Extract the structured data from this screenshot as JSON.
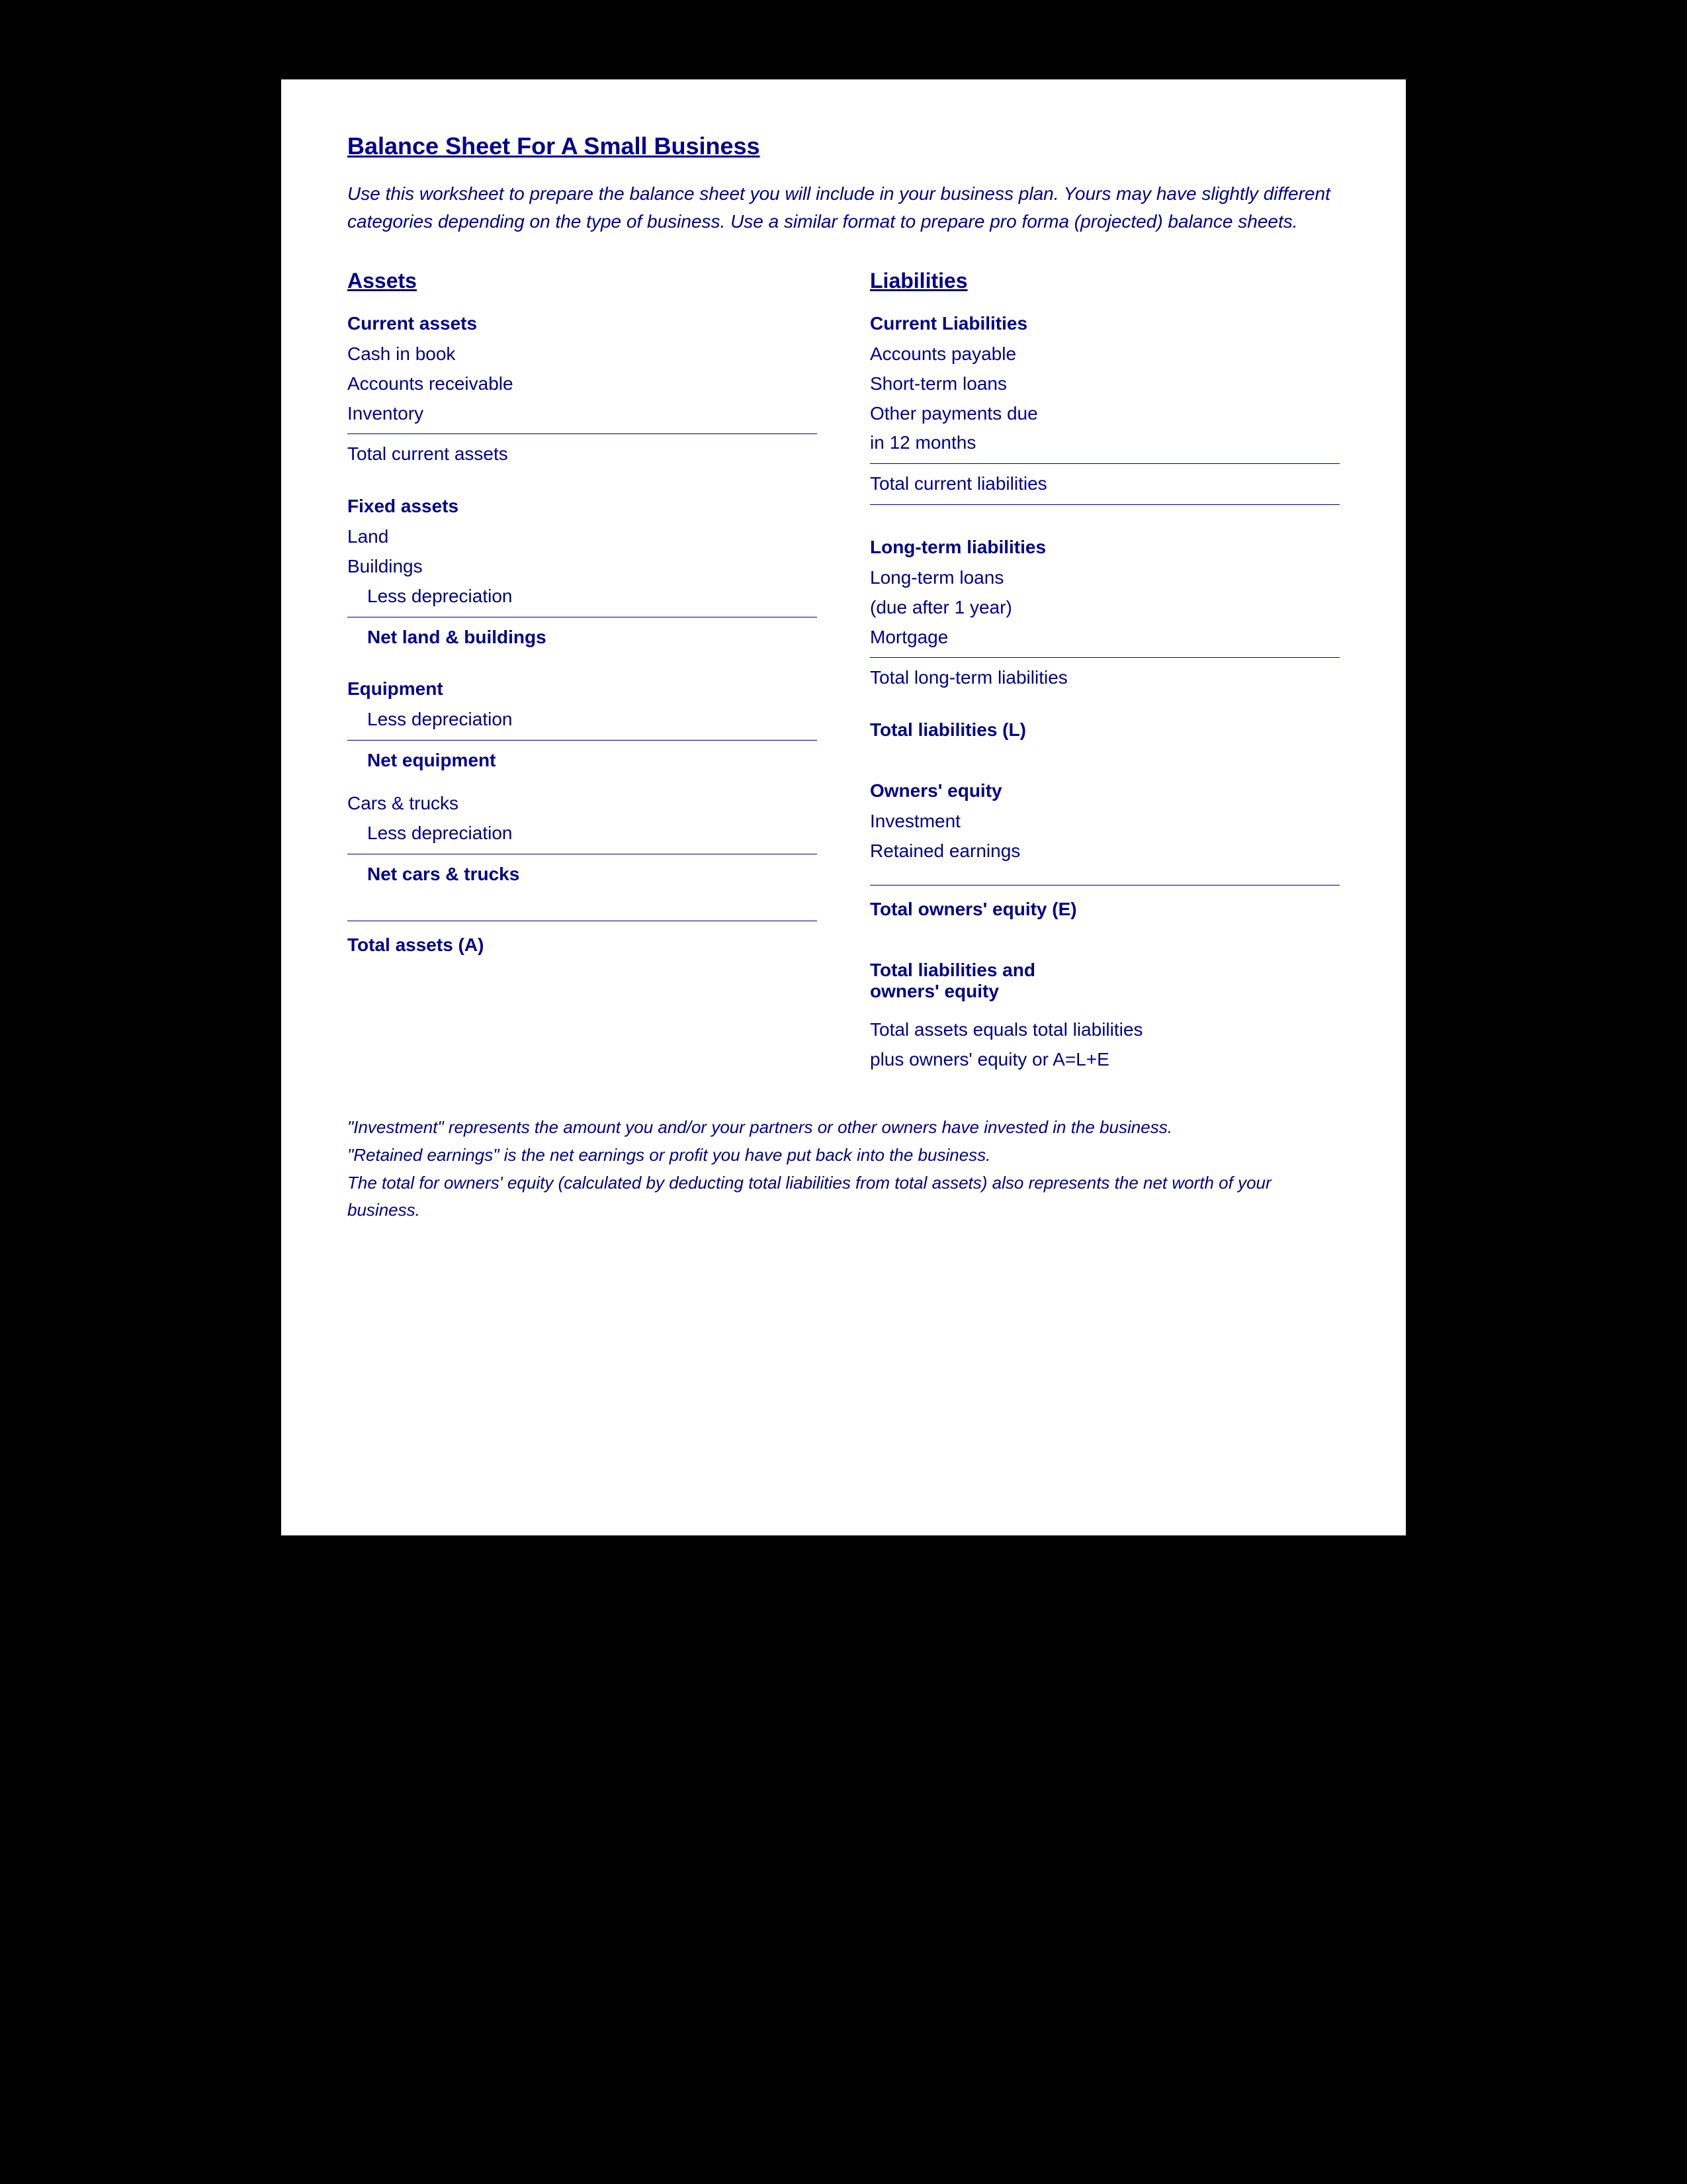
{
  "page": {
    "title": "Balance Sheet For A Small Business",
    "intro": "Use this worksheet to prepare the balance sheet you will include in your business plan.  Yours may have slightly different categories depending on the type of business.  Use a similar format to prepare pro forma (projected) balance sheets.",
    "assets": {
      "header": "Assets",
      "current_assets": {
        "header": "Current assets",
        "items": [
          "Cash in book",
          "Accounts receivable",
          "Inventory",
          "Total current assets"
        ]
      },
      "fixed_assets": {
        "header": "Fixed assets",
        "items": [
          "Land",
          "Buildings",
          "Less depreciation",
          "Net land & buildings"
        ]
      },
      "equipment": {
        "header": "Equipment",
        "items": [
          "Less depreciation",
          "Net equipment"
        ]
      },
      "cars_trucks": {
        "header": "Cars & trucks",
        "items": [
          "Less depreciation",
          "Net cars & trucks"
        ]
      },
      "total": "Total assets (A)"
    },
    "liabilities": {
      "header": "Liabilities",
      "current_liabilities": {
        "header": "Current Liabilities",
        "items": [
          "Accounts payable",
          "Short-term loans",
          "Other payments due",
          " in 12 months",
          "Total current liabilities"
        ]
      },
      "long_term": {
        "header": "Long-term liabilities",
        "items": [
          "Long-term loans",
          " (due after 1 year)",
          "Mortgage",
          "Total long-term liabilities"
        ]
      },
      "total_liabilities": "Total liabilities (L)",
      "owners_equity": {
        "header": "Owners' equity",
        "items": [
          "Investment",
          "Retained earnings"
        ]
      },
      "total_equity": "Total owners' equity (E)",
      "total_liabilities_equity": {
        "line1": "Total liabilities and",
        "line2": " owners' equity",
        "line3": "Total assets equals total liabilities",
        "line4": " plus owners' equity or A=L+E"
      }
    },
    "footnotes": [
      "\"Investment\" represents the amount you and/or your partners or other owners have invested in the business.",
      " \"Retained earnings\" is the net earnings or profit you have put back into the business.",
      "The total for owners' equity (calculated by deducting total liabilities from total assets) also represents the net worth of your business."
    ]
  }
}
